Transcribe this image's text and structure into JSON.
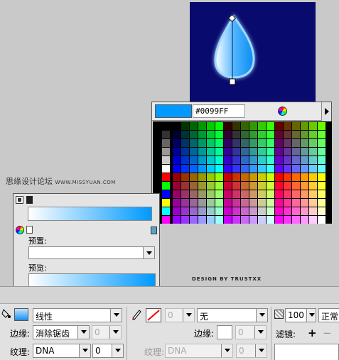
{
  "colors": {
    "current": "#0099FF",
    "stage_bg": "#080a6e",
    "gradient_start": "#ffffff",
    "gradient_end": "#0099ff"
  },
  "swatch_popup": {
    "hex_value": "#0099FF",
    "icons": [
      "color-wheel-icon",
      "menu-arrow-icon"
    ]
  },
  "watermark": {
    "site_cn": "思缘设计论坛",
    "site_url": "WWW.MISSYUAN.COM",
    "credit": "DESIGN BY TRUSTXX"
  },
  "gradient_panel": {
    "preset_label": "预置:",
    "preset_value": "",
    "preview_label": "预览:"
  },
  "properties": {
    "fill_type": "线性",
    "edge_label": "边缘:",
    "edge_value": "消除锯齿",
    "edge_number": "0",
    "texture_label": "纹理:",
    "texture_value": "DNA",
    "texture_number": "0",
    "stroke_size": "0",
    "stroke_type": "无",
    "stroke_edge_label": "边缘:",
    "stroke_edge_number": "0",
    "stroke_texture_label": "纹理:",
    "stroke_texture_value": "DNA",
    "stroke_texture_number": "0",
    "opacity": "100",
    "blend_mode": "正常",
    "filters_label": "滤镜:",
    "add_filter": "+",
    "remove_filter": "−"
  }
}
